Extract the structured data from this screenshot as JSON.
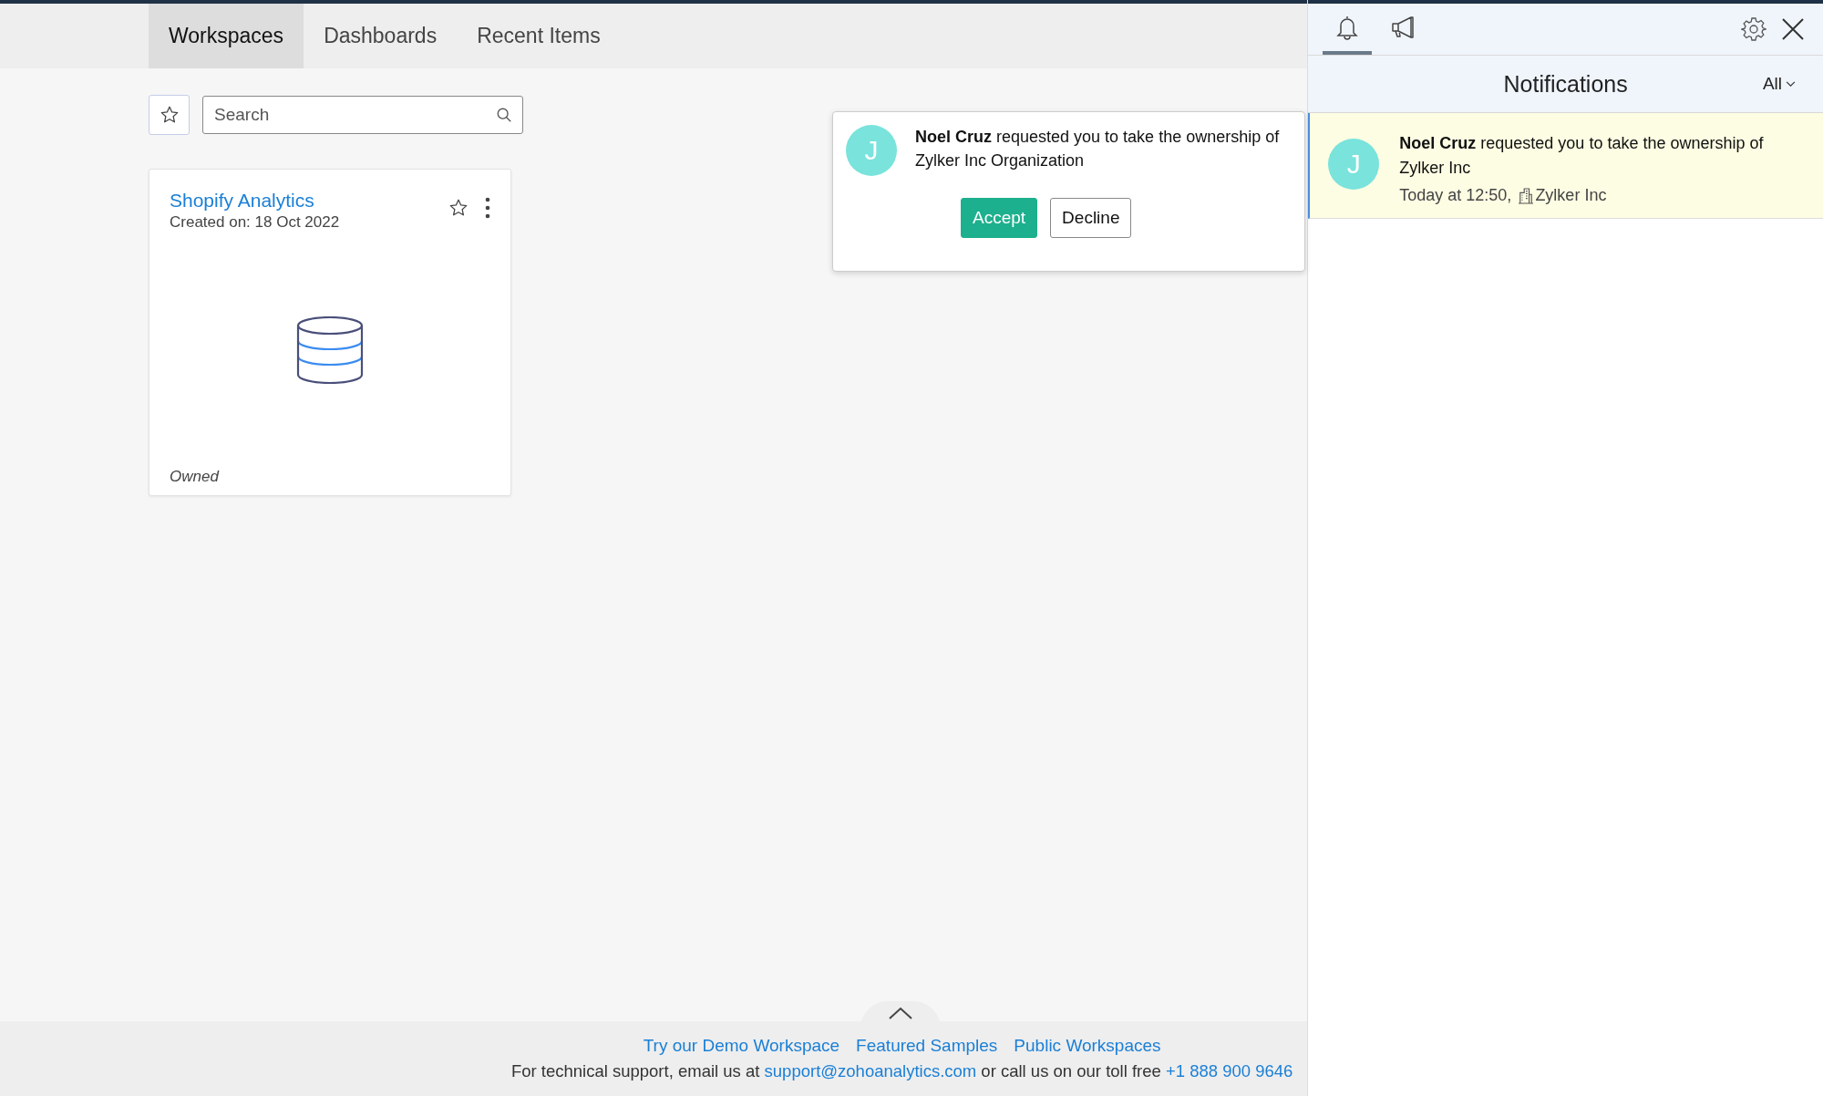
{
  "tabs": [
    {
      "label": "Workspaces",
      "selected": true
    },
    {
      "label": "Dashboards",
      "selected": false
    },
    {
      "label": "Recent Items",
      "selected": false
    }
  ],
  "search": {
    "placeholder": "Search"
  },
  "workspaces": [
    {
      "title": "Shopify Analytics",
      "created": "Created on: 18 Oct 2022",
      "ownership": "Owned"
    }
  ],
  "popup": {
    "initial": "J",
    "message": "**Noel Cruz** requested you to take the ownership of Zylker Inc Organization",
    "buttons": [
      {
        "label": "Accept",
        "kind": "primary"
      },
      {
        "label": "Decline",
        "kind": "secondary"
      }
    ]
  },
  "panel": {
    "tabs": [
      {
        "kind": "bell",
        "selected": true
      },
      {
        "kind": "megaphone",
        "selected": false
      }
    ],
    "title": "Notifications",
    "filter": "All",
    "notifications": [
      {
        "initial": "J",
        "message": "**Noel Cruz** requested you to take the ownership of Zylker Inc",
        "time": "Today at 12:50,",
        "organization": "Zylker Inc",
        "unread": true
      }
    ]
  },
  "footer": {
    "links": [
      "Try our Demo Workspace",
      "Featured Samples",
      "Public Workspaces"
    ],
    "support_prefix": "For technical support, email us at ",
    "email": "support@zohoanalytics.com",
    "support_middle": " or call us on our toll free ",
    "phone": "+1 888 900 9646"
  }
}
